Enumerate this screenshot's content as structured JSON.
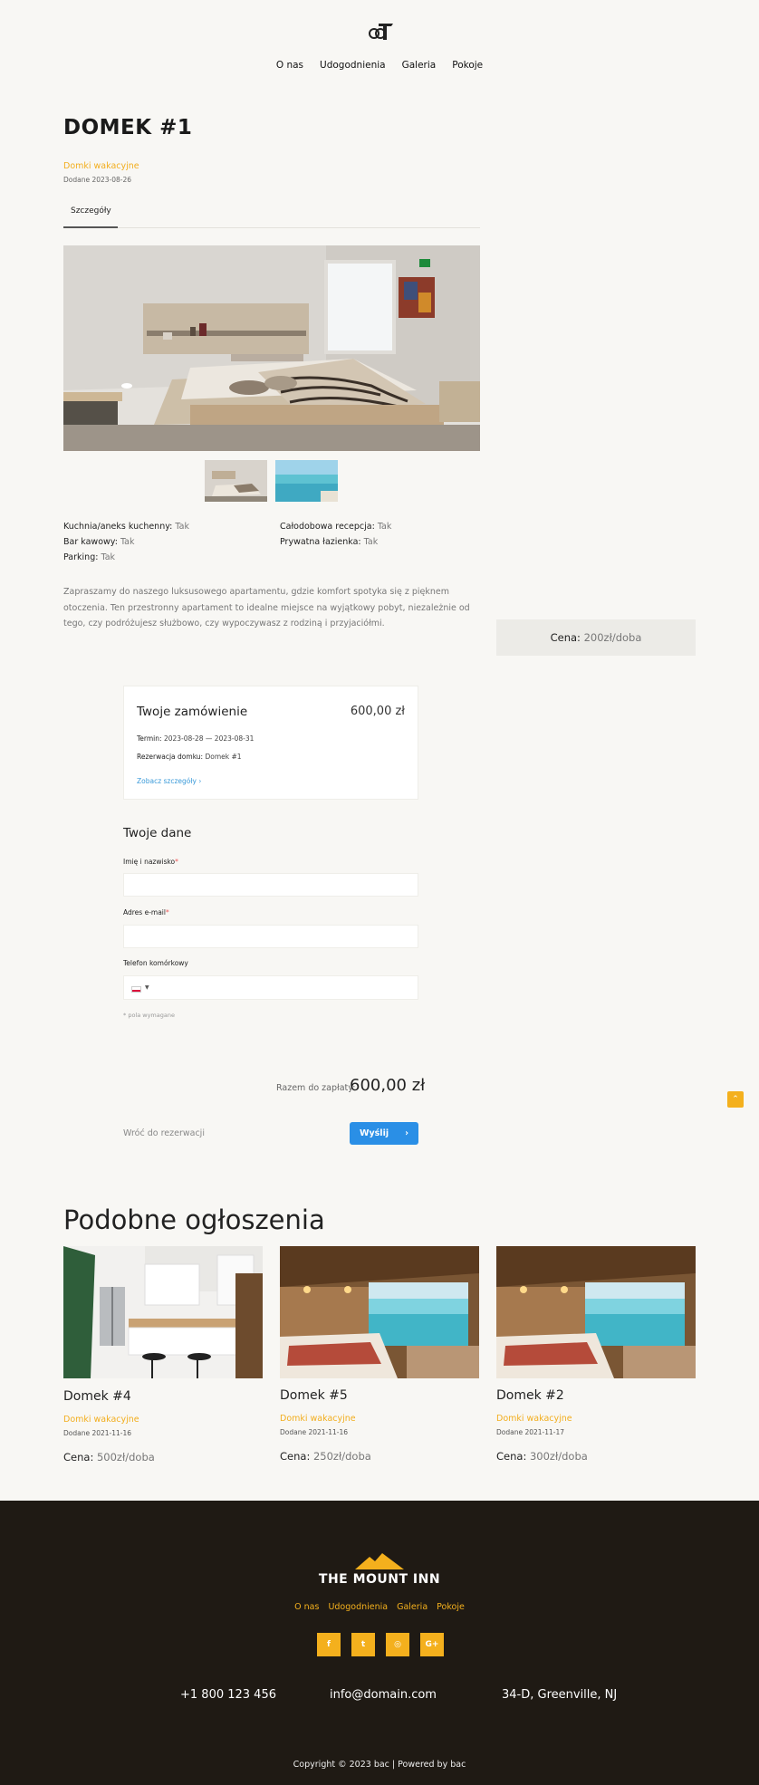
{
  "nav": {
    "items": [
      "O nas",
      "Udogodnienia",
      "Galeria",
      "Pokoje"
    ]
  },
  "listing": {
    "title": "DOMEK #1",
    "category": "Domki wakacyjne",
    "added": "Dodane 2023-08-26",
    "tab": "Szczegóły",
    "features": [
      {
        "label": "Kuchnia/aneks kuchenny:",
        "value": "Tak"
      },
      {
        "label": "Całodobowa recepcja:",
        "value": "Tak"
      },
      {
        "label": "Bar kawowy:",
        "value": "Tak"
      },
      {
        "label": "Prywatna łazienka:",
        "value": "Tak"
      },
      {
        "label": "Parking:",
        "value": "Tak"
      }
    ],
    "description": "Zapraszamy do naszego luksusowego apartamentu, gdzie komfort spotyka się z pięknem otoczenia. Ten przestronny apartament to idealne miejsce na wyjątkowy pobyt, niezależnie od tego, czy podróżujesz służbowo, czy wypoczywasz z rodziną i przyjaciółmi.",
    "price_label": "Cena:",
    "price_value": "200zł/doba"
  },
  "order": {
    "title": "Twoje zamówienie",
    "total": "600,00 zł",
    "term_label": "Termin:",
    "term_value": "2023-08-28 — 2023-08-31",
    "booking_label": "Rezerwacja domku:",
    "booking_value": "Domek #1",
    "details_link": "Zobacz szczegóły ›"
  },
  "form": {
    "title": "Twoje dane",
    "name_label": "Imię i nazwisko",
    "email_label": "Adres e-mail",
    "phone_label": "Telefon komórkowy",
    "required_mark": "*",
    "required_note": "* pola wymagane",
    "total_label": "Razem do zapłaty:",
    "total_value": "600,00 zł",
    "back_link": "Wróć do rezerwacji",
    "send_label": "Wyślij",
    "send_arrow": "›"
  },
  "similar": {
    "title": "Podobne ogłoszenia",
    "cards": [
      {
        "name": "Domek #4",
        "category": "Domki wakacyjne",
        "date": "Dodane 2021-11-16",
        "price_label": "Cena:",
        "price": "500zł/doba"
      },
      {
        "name": "Domek #5",
        "category": "Domki wakacyjne",
        "date": "Dodane 2021-11-16",
        "price_label": "Cena:",
        "price": "250zł/doba"
      },
      {
        "name": "Domek #2",
        "category": "Domki wakacyjne",
        "date": "Dodane 2021-11-17",
        "price_label": "Cena:",
        "price": "300zł/doba"
      }
    ]
  },
  "footer": {
    "brand": "THE MOUNT INN",
    "nav": [
      "O nas",
      "Udogodnienia",
      "Galeria",
      "Pokoje"
    ],
    "social_icons": [
      "facebook-icon",
      "twitter-icon",
      "instagram-icon",
      "google-plus-icon"
    ],
    "social_glyphs": [
      "f",
      "t",
      "◎",
      "G+"
    ],
    "phone": "+1 800 123 456",
    "email": "info@domain.com",
    "address": "34-D, Greenville, NJ",
    "copyright": "Copyright © 2023 bac | Powered by bac"
  },
  "totop_glyph": "⌃",
  "colors": {
    "accent": "#f4b01d",
    "link": "#3a9ad9",
    "button": "#2a8fe6",
    "footer_bg": "#1f1a14",
    "background": "#f8f7f4"
  }
}
